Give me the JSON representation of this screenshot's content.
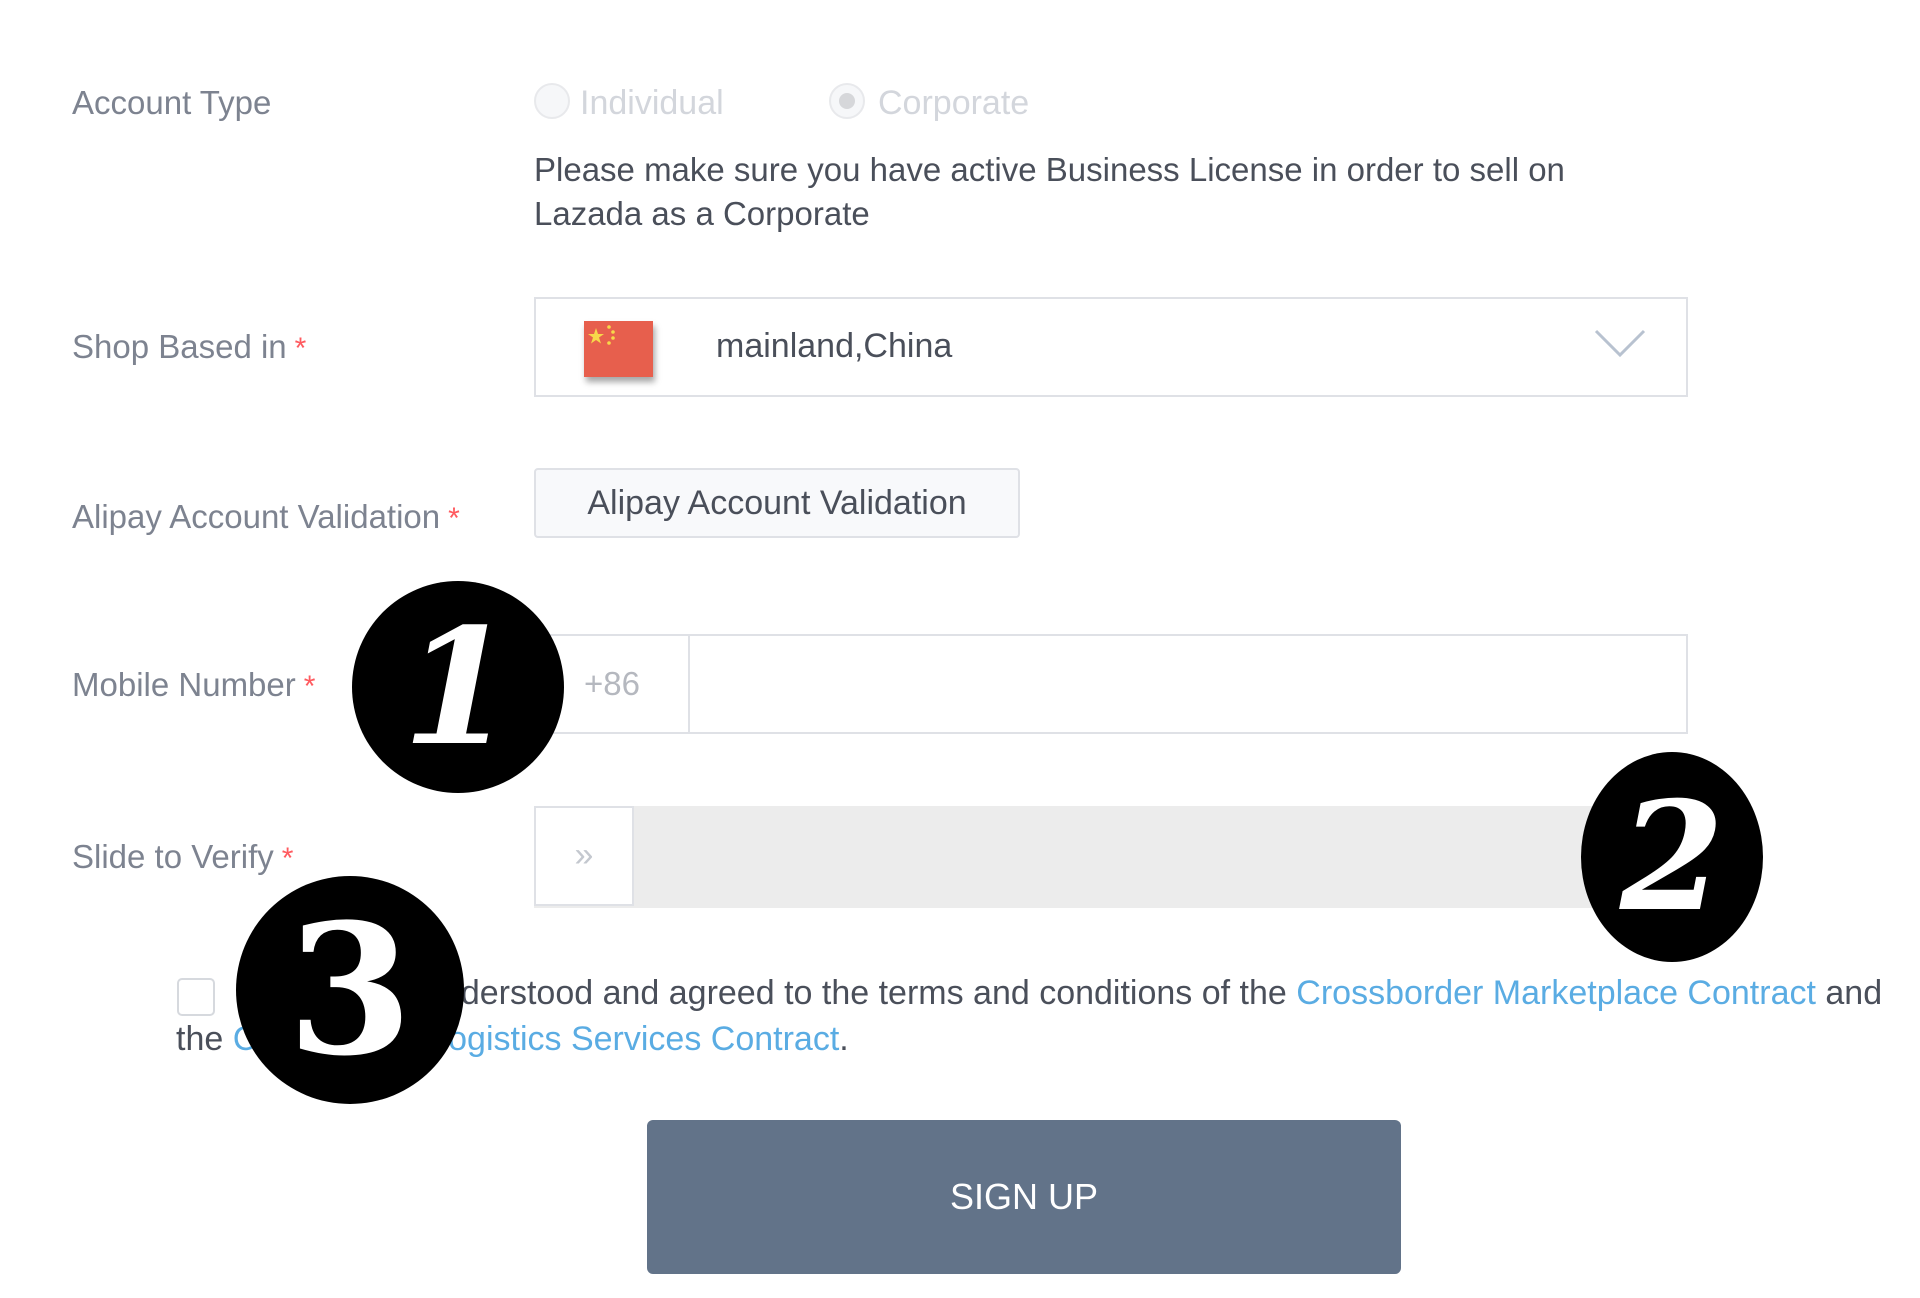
{
  "form": {
    "account_type": {
      "label": "Account Type",
      "options": [
        {
          "label": "Individual",
          "selected": false
        },
        {
          "label": "Corporate",
          "selected": true
        }
      ],
      "note": "Please make sure you have active Business License in order to sell on Lazada as a Corporate"
    },
    "shop_based_in": {
      "label": "Shop Based in",
      "required_mark": "*",
      "value": "mainland,China",
      "flag_icon": "china-flag-icon"
    },
    "alipay": {
      "label": "Alipay Account Validation",
      "required_mark": "*",
      "button_label": "Alipay Account Validation"
    },
    "mobile": {
      "label": "Mobile Number",
      "required_mark": "*",
      "country_code": "+86",
      "value": "",
      "placeholder": ""
    },
    "slide_verify": {
      "label": "Slide to Verify",
      "required_mark": "*",
      "handle_glyph": "»",
      "progress": 0
    },
    "agreement": {
      "checked": false,
      "text_before": "I have read, understood and agreed to the terms and conditions of the ",
      "link1": "Crossborder Marketplace Contract",
      "text_middle": " and the ",
      "link2": "Crossborder Logistics Services Contract",
      "text_after": "."
    },
    "signup_label": "SIGN UP"
  },
  "annotations": [
    {
      "number": "1"
    },
    {
      "number": "2"
    },
    {
      "number": "3"
    }
  ],
  "colors": {
    "primary_button": "#627389",
    "link": "#5aace3",
    "required": "#ff5a5f"
  }
}
